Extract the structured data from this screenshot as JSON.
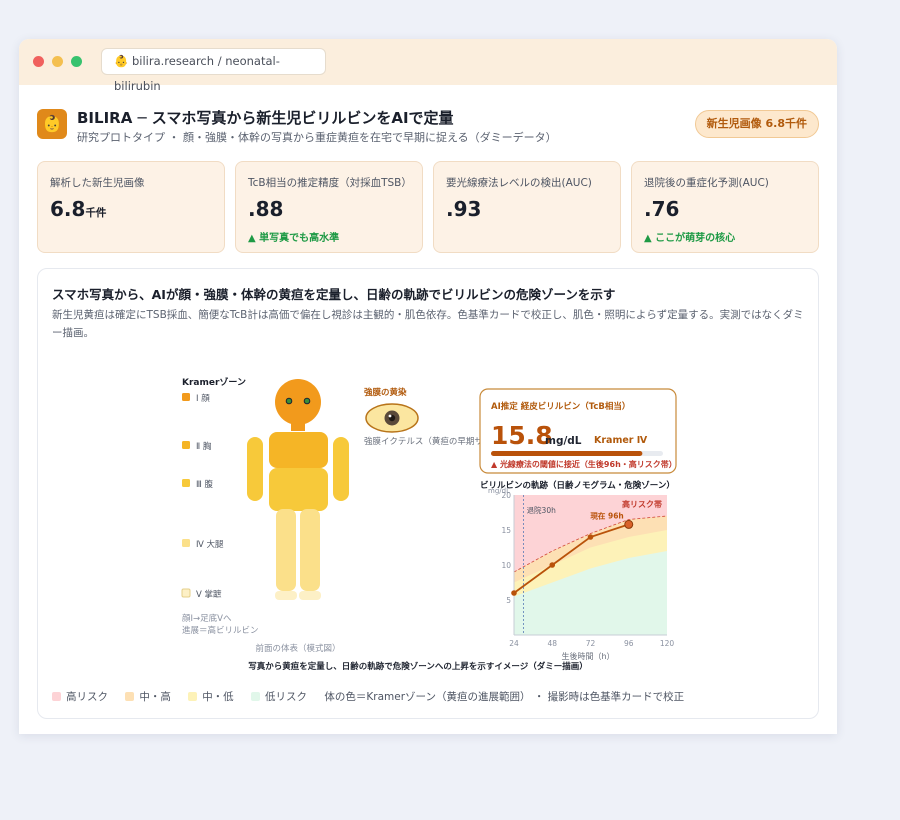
{
  "window": {
    "url": "👶 bilira.research / neonatal-bilirubin",
    "dots": [
      "#f0605d",
      "#f4bf4f",
      "#37c26e"
    ]
  },
  "header": {
    "logo": "👶",
    "title": "BILIRA ─ スマホ写真から新生児ビリルビンをAIで定量",
    "subtitle": "研究プロトタイプ ・ 顔・強膜・体幹の写真から重症黄疸を在宅で早期に捉える（ダミーデータ）",
    "badge": "新生児画像 6.8千件"
  },
  "stats": [
    {
      "label": "解析した新生児画像",
      "value": "6.8",
      "unit": "千件",
      "note": ""
    },
    {
      "label": "TcB相当の推定精度（対採血TSB）",
      "value": ".88",
      "unit": "",
      "note": "▲ 単写真でも高水準"
    },
    {
      "label": "要光線療法レベルの検出(AUC)",
      "value": ".93",
      "unit": "",
      "note": ""
    },
    {
      "label": "退院後の重症化予測(AUC)",
      "value": ".76",
      "unit": "",
      "note": "▲ ここが萌芽の核心"
    }
  ],
  "panel": {
    "title": "スマホ写真から、AIが顔・強膜・体幹の黄疸を定量し、日齢の軌跡でビリルビンの危険ゾーンを示す",
    "desc": "新生児黄疸は確定にTSB採血、簡便なTcB計は高価で偏在し視診は主観的・肌色依存。色基準カードで校正し、肌色・照明によらず定量する。実測ではなくダミー描画。"
  },
  "figure": {
    "kramer_title": "Kramerゾーン",
    "zones": [
      "Ⅰ 顔",
      "Ⅱ 胸",
      "Ⅲ 腹",
      "Ⅳ 大腿",
      "Ⅴ 掌蹠"
    ],
    "zone_colors": [
      "#f29a1c",
      "#f5b526",
      "#f7c93a",
      "#fbe08a",
      "#fdf0c6"
    ],
    "zone_note_1": "顔Ⅰ→足底Ⅴへ",
    "zone_note_2": "進展＝高ビリルビン",
    "body_caption": "前面の体表（模式図）",
    "eye_title": "強膜の黄染",
    "eye_caption": "強膜イクテルス（黄疸の早期サイン）",
    "ai_box": {
      "title": "AI推定 経皮ビリルビン（TcB相当）",
      "value": "15.8",
      "unit": "mg/dL",
      "zone": "Kramer Ⅳ",
      "level": 0.88,
      "alert": "▲ 光線療法の閾値に接近（生後96h・高リスク帯）"
    },
    "caption": "写真から黄疸を定量し、日齢の軌跡で危険ゾーンへの上昇を示すイメージ（ダミー描画）"
  },
  "chart_data": {
    "type": "line",
    "title": "ビリルビンの軌跡（日齢ノモグラム・危険ゾーン）",
    "ylabel": "mg/dL",
    "xlabel": "生後時間（h）",
    "x_ticks": [
      24,
      48,
      72,
      96,
      120
    ],
    "y_ticks": [
      5,
      10,
      15,
      20
    ],
    "xlim": [
      24,
      120
    ],
    "ylim": [
      0,
      20
    ],
    "series": [
      {
        "x": [
          24,
          48,
          72,
          96
        ],
        "y": [
          6.0,
          10.0,
          14.0,
          15.8
        ]
      }
    ],
    "zones": {
      "x": [
        24,
        48,
        72,
        96,
        120
      ],
      "low_upper": [
        5.5,
        7.5,
        9.5,
        11.0,
        12.0
      ],
      "mid_low_upper": [
        7.5,
        10.0,
        12.5,
        14.0,
        15.0
      ],
      "mid_high_upper": [
        9.0,
        12.0,
        14.5,
        16.5,
        17.0
      ],
      "top": 20
    },
    "annotations": {
      "high_risk": "高リスク帯",
      "discharge": "退院30h",
      "discharge_x": 30,
      "current": "現在 96h"
    }
  },
  "legend": {
    "items": [
      {
        "label": "高リスク",
        "color": "#fdd3d6"
      },
      {
        "label": "中・高",
        "color": "#fde0b4"
      },
      {
        "label": "中・低",
        "color": "#fdf2b8"
      },
      {
        "label": "低リスク",
        "color": "#e1f7ea"
      }
    ],
    "note": "体の色＝Kramerゾーン（黄疸の進展範囲） ・ 撮影時は色基準カードで校正"
  }
}
